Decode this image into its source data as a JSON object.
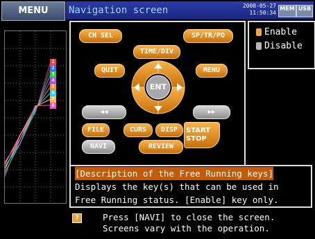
{
  "menu_tab": "MENU",
  "title": "Navigation screen",
  "datetime": {
    "date": "2008-05-27",
    "time": "11:50:34"
  },
  "status_tags": {
    "mem": "MEM",
    "usb": "USB"
  },
  "channels": [
    "1",
    "2",
    "3",
    "4",
    "5",
    "6",
    "7",
    "8"
  ],
  "channel_colors": [
    "#ff3b3b",
    "#3b6bff",
    "#2ecc40",
    "#b04bff",
    "#ff8c2a",
    "#2ad4ff",
    "#ffb84a",
    "#ff4fc8"
  ],
  "buttons": {
    "ch_sel": "CH SEL",
    "sp_tr_po": "SP/TR/PO",
    "time_div": "TIME/DIV",
    "quit": "QUIT",
    "menu": "MENU",
    "ent": "ENT",
    "rewind": "◀◀",
    "forward": "▶▶",
    "file": "FILE",
    "curs": "CURS",
    "disp": "DISP",
    "start": "START",
    "stop": "STOP",
    "navi": "NAVI",
    "review": "REVIEW"
  },
  "legend": {
    "enable": "Enable",
    "disable": "Disable",
    "enable_color": "#f7a537",
    "disable_color": "#b5b5b5"
  },
  "description": {
    "title": "[Description of the Free Running keys]",
    "line1": "Displays the key(s) that can be used in",
    "line2": "Free Running status. [Enable] key only."
  },
  "help": {
    "icon": "?",
    "line1": "Press [NAVI] to close the screen.",
    "line2": "Screens vary with the operation."
  }
}
